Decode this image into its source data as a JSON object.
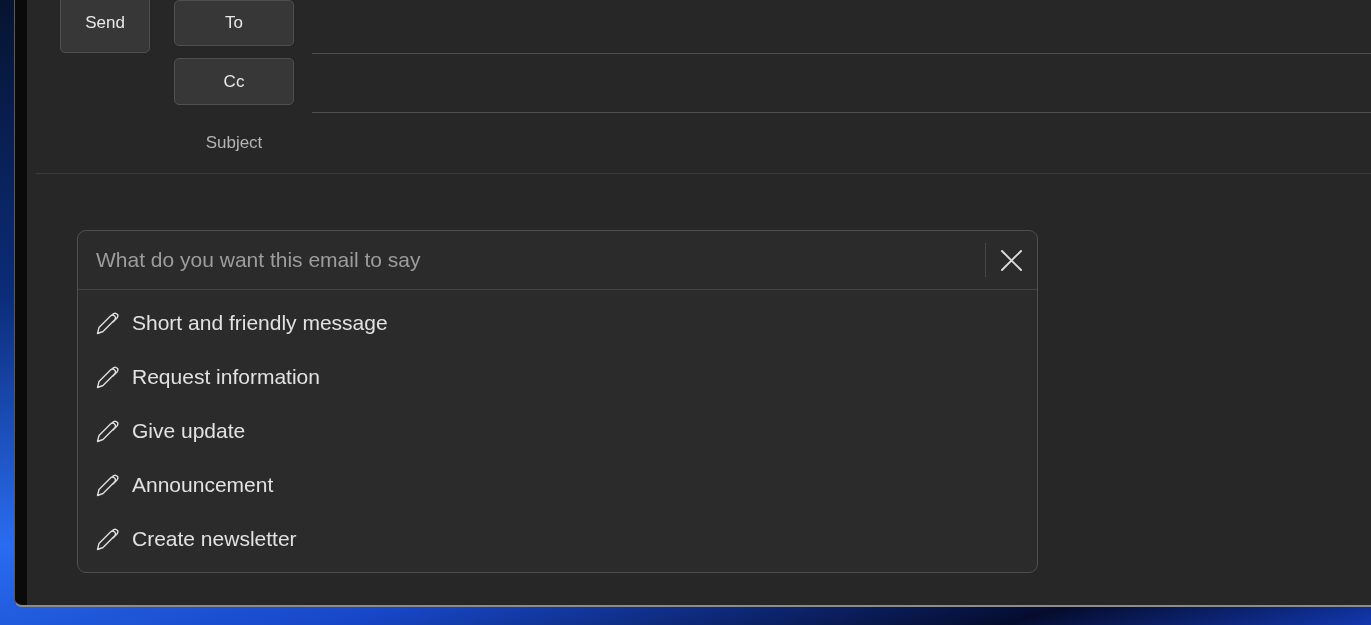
{
  "compose": {
    "send_button": "Send",
    "to_button": "To",
    "cc_button": "Cc",
    "subject_label": "Subject"
  },
  "draft_prompt": {
    "placeholder": "What do you want this email to say",
    "suggestions": [
      "Short and friendly message",
      "Request information",
      "Give update",
      "Announcement",
      "Create newsletter"
    ]
  }
}
